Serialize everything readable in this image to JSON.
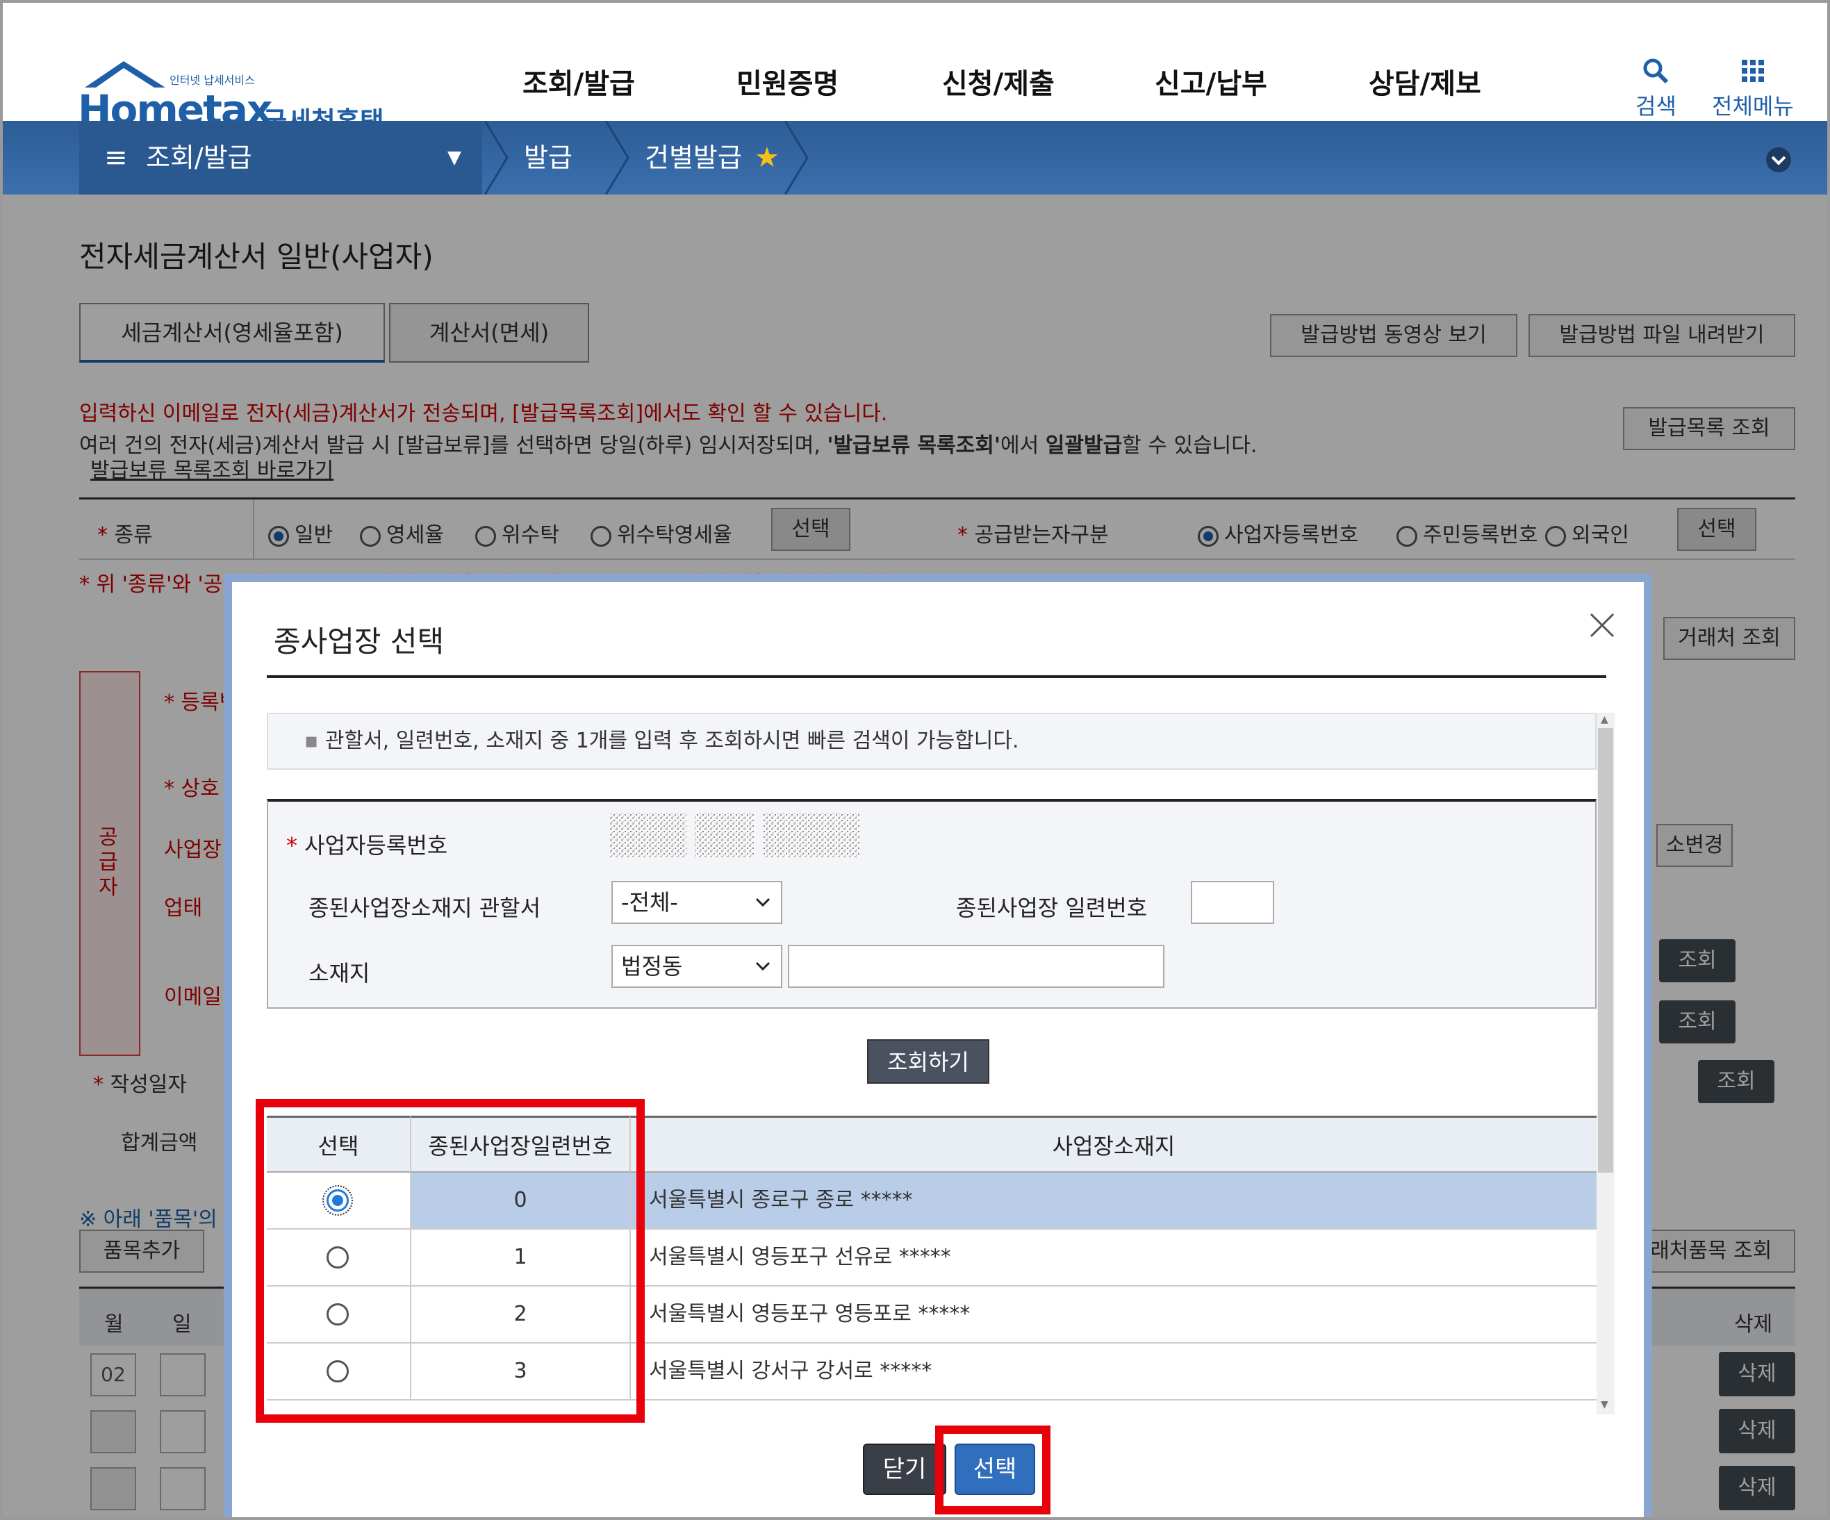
{
  "header": {
    "logo_text": "Hometax",
    "logo_tagline": "인터넷 납세서비스",
    "logo_kr": "국세청홈택스",
    "gnb": [
      "조회/발급",
      "민원증명",
      "신청/제출",
      "신고/납부",
      "상담/제보"
    ],
    "search_label": "검색",
    "allmenu_label": "전체메뉴"
  },
  "subnav": {
    "menu": "조회/발급",
    "crumb1": "발급",
    "crumb2": "건별발급"
  },
  "page": {
    "title": "전자세금계산서 일반(사업자)",
    "tab1": "세금계산서(영세율포함)",
    "tab2": "계산서(면세)",
    "btn_video": "발급방법 동영상 보기",
    "btn_file": "발급방법 파일 내려받기",
    "notice_red": "입력하신 이메일로 전자(세금)계산서가 전송되며, [발급목록조회]에서도 확인 할 수 있습니다.",
    "notice_pre": "여러 건의 전자(세금)계산서 발급 시 [발급보류]를 선택하면 당일(하루) 임시저장되며, ",
    "notice_bold1": "'발급보류 목록조회'",
    "notice_mid": "에서 ",
    "notice_bold2": "일괄발급",
    "notice_post": "할 수 있습니다.",
    "link_hold": "발급보류 목록조회 바로가기",
    "btn_issue_list": "발급목록 조회",
    "kind_label": "종류",
    "kind_options": [
      "일반",
      "영세율",
      "위수탁",
      "위수탁영세율"
    ],
    "kind_select": "선택",
    "recv_label": "공급받는자구분",
    "recv_options": [
      "사업자등록번호",
      "주민등록번호",
      "외국인"
    ],
    "recv_select": "선택",
    "warn": "위 '종류'와 '공급받는자 구분'을 변경하신 후 [선택]버튼을 누르시면 아래 사항이 변경됩니다.",
    "supplier_side": "공급자",
    "reg_label": "등록번호",
    "name_label": "상호",
    "biz_label": "사업장",
    "type_label": "업태",
    "email_label": "이메일",
    "btn_partner": "거래처 조회",
    "btn_change": "소변경",
    "btn_lookup": "조회",
    "date_label": "작성일자",
    "total_label": "합계금액",
    "item_note": "※ 아래 '품목'의",
    "btn_add_item": "품목추가",
    "btn_partner_item": "거래처품목 조회",
    "col_month": "월",
    "col_day": "일",
    "col_delete": "삭제",
    "month_value": "02",
    "delete_label": "삭제"
  },
  "modal": {
    "title": "종사업장 선택",
    "info": "관할서, 일련번호, 소재지 중 1개를 입력 후 조회하시면 빠른 검색이 가능합니다.",
    "reg_label": "사업자등록번호",
    "office_label": "종된사업장소재지 관할서",
    "office_value": "-전체-",
    "serial_label": "종된사업장 일련번호",
    "addr_label": "소재지",
    "addr_select": "법정동",
    "search_button": "조회하기",
    "columns": [
      "선택",
      "종된사업장일련번호",
      "사업장소재지"
    ],
    "rows": [
      {
        "serial": "0",
        "address": "서울특별시 종로구 종로 *****",
        "selected": true
      },
      {
        "serial": "1",
        "address": "서울특별시 영등포구 선유로 *****",
        "selected": false
      },
      {
        "serial": "2",
        "address": "서울특별시 영등포구 영등포로 *****",
        "selected": false
      },
      {
        "serial": "3",
        "address": "서울특별시 강서구 강서로 *****",
        "selected": false
      }
    ],
    "close_button": "닫기",
    "select_button": "선택"
  },
  "colors": {
    "brand_blue": "#1f5fa8",
    "nav_blue": "#3567a3",
    "highlight_red": "#e8000b",
    "selected_row": "#b9cde8"
  }
}
